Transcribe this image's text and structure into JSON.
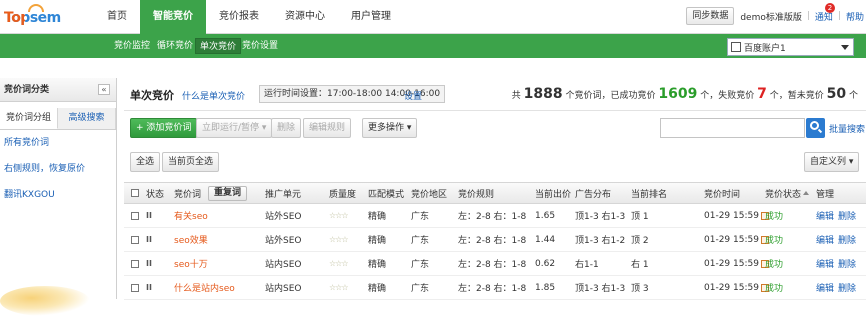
{
  "logo": {
    "text": "Topsem"
  },
  "nav": {
    "items": [
      "首页",
      "智能竞价",
      "竞价报表",
      "资源中心",
      "用户管理"
    ],
    "active": 1
  },
  "topright": {
    "sync": "同步数据",
    "edition": "demo标准版版",
    "notice": "通知",
    "notice_count": "2",
    "help": "帮助"
  },
  "subnav": {
    "items": [
      "竞价监控",
      "循环竞价",
      "单次竞价",
      "竞价设置"
    ],
    "active": 2,
    "account": "百度账户1"
  },
  "sidebar": {
    "title": "竞价词分类",
    "collapse": "«",
    "tabs": [
      "竞价词分组",
      "高级搜索"
    ],
    "links": [
      "所有竞价词",
      "右侧规则，恢复原价",
      "翻讯KXGOU"
    ]
  },
  "main": {
    "title": "单次竞价",
    "what": "什么是单次竞价",
    "runtime": "运行时间设置：17:00-18:00 14:00-16:00",
    "set_link": "设置",
    "stats": {
      "prefix": "共",
      "total": "1888",
      "mid1": "个竞价词，已成功竞价",
      "success": "1609",
      "mid2": "个，失败竞价",
      "fail": "7",
      "mid3": "个，暂未竞价",
      "pending": "50",
      "suffix": "个"
    }
  },
  "toolbar": {
    "add": "+ 添加竞价词",
    "run": "立即运行/暂停 ▾",
    "delete": "删除",
    "edit_rule": "编辑规则",
    "more": "更多操作 ▾",
    "bulk_search": "批量搜索",
    "select_all": "全选",
    "select_page": "当前页全选",
    "custom_col": "自定义列 ▾"
  },
  "table": {
    "headers": {
      "status": "状态",
      "keyword": "竞价词",
      "repeat": "重复词",
      "unit": "推广单元",
      "quality": "质量度",
      "match": "匹配模式",
      "region": "竞价地区",
      "rule": "竞价规则",
      "price": "当前出价",
      "ad": "广告分布",
      "rank": "当前排名",
      "time": "竞价时间",
      "bid_status": "竞价状态",
      "manage": "管理"
    },
    "rows": [
      {
        "status": "II",
        "keyword": "有关seo",
        "unit": "站外SEO",
        "quality": "☆☆☆",
        "match": "精确",
        "region": "广东",
        "rule": "左：2-8 右：1-8",
        "price": "1.65",
        "ad": "顶1-3 右1-3",
        "rank": "顶 1",
        "time": "01-29 15:59",
        "bid_status": "成功",
        "edit": "编辑",
        "del": "删除"
      },
      {
        "status": "II",
        "keyword": "seo效果",
        "unit": "站外SEO",
        "quality": "☆☆☆",
        "match": "精确",
        "region": "广东",
        "rule": "左：2-8 右：1-8",
        "price": "1.44",
        "ad": "顶1-3 右1-2",
        "rank": "顶 2",
        "time": "01-29 15:59",
        "bid_status": "成功",
        "edit": "编辑",
        "del": "删除"
      },
      {
        "status": "II",
        "keyword": "seo十万",
        "unit": "站内SEO",
        "quality": "☆☆☆",
        "match": "精确",
        "region": "广东",
        "rule": "左：2-8 右：1-8",
        "price": "0.62",
        "ad": "右1-1",
        "rank": "右 1",
        "time": "01-29 15:59",
        "bid_status": "成功",
        "edit": "编辑",
        "del": "删除"
      },
      {
        "status": "II",
        "keyword": "什么是站内seo",
        "unit": "站内SEO",
        "quality": "☆☆☆",
        "match": "精确",
        "region": "广东",
        "rule": "左：2-8 右：1-8",
        "price": "1.85",
        "ad": "顶1-3 右1-3",
        "rank": "顶 3",
        "time": "01-29 15:59",
        "bid_status": "成功",
        "edit": "编辑",
        "del": "删除"
      }
    ]
  },
  "colors": {
    "green": "#3ca34a",
    "link": "#1a5fb4",
    "keyword": "#e5591b"
  }
}
